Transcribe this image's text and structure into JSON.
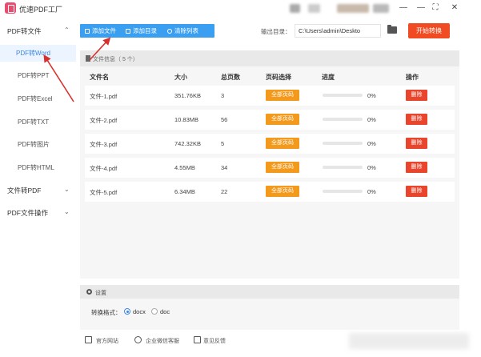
{
  "app": {
    "title": "优速PDF工厂"
  },
  "window_controls": [
    "—",
    "⛶",
    "—",
    "✕"
  ],
  "sidebar": {
    "groups": [
      {
        "label": "PDF转文件",
        "expanded": true,
        "chevron": "⌃",
        "items": [
          "PDF转Word",
          "PDF转PPT",
          "PDF转Excel",
          "PDF转TXT",
          "PDF转图片",
          "PDF转HTML"
        ],
        "active": "PDF转Word"
      },
      {
        "label": "文件转PDF",
        "expanded": false,
        "chevron": "⌄"
      },
      {
        "label": "PDF文件操作",
        "expanded": false,
        "chevron": "⌄"
      }
    ]
  },
  "toolbar": {
    "add_file": "添加文件",
    "add_dir": "添加目录",
    "clear_list": "清除列表",
    "output_label": "输出目录：",
    "output_path": "C:\\Users\\admin\\Deskto",
    "start_button": "开始转换"
  },
  "file_panel": {
    "header": "文件信息（ 5 个）",
    "columns": [
      "文件名",
      "大小",
      "总页数",
      "页码选择",
      "进度",
      "操作"
    ],
    "rows": [
      {
        "name": "文件-1.pdf",
        "size": "351.76KB",
        "pages": "3",
        "page_select": "全部页码",
        "progress": "0%",
        "progress_value": 0,
        "action": "删除"
      },
      {
        "name": "文件-2.pdf",
        "size": "10.83MB",
        "pages": "56",
        "page_select": "全部页码",
        "progress": "0%",
        "progress_value": 0,
        "action": "删除"
      },
      {
        "name": "文件-3.pdf",
        "size": "742.32KB",
        "pages": "5",
        "page_select": "全部页码",
        "progress": "0%",
        "progress_value": 0,
        "action": "删除"
      },
      {
        "name": "文件-4.pdf",
        "size": "4.55MB",
        "pages": "34",
        "page_select": "全部页码",
        "progress": "0%",
        "progress_value": 0,
        "action": "删除"
      },
      {
        "name": "文件-5.pdf",
        "size": "6.34MB",
        "pages": "22",
        "page_select": "全部页码",
        "progress": "0%",
        "progress_value": 0,
        "action": "删除"
      }
    ]
  },
  "settings": {
    "header": "设置",
    "format_label": "转换格式：",
    "options": [
      "docx",
      "doc"
    ],
    "selected": "docx"
  },
  "footer": {
    "links": [
      "官方网站",
      "企业微信客服",
      "意见反馈"
    ]
  },
  "colors": {
    "accent_blue": "#3a9ff0",
    "start_orange": "#f04b22",
    "page_select_orange": "#f39a1d",
    "delete_red": "#e8452c",
    "annotation_red": "#d9302c"
  }
}
